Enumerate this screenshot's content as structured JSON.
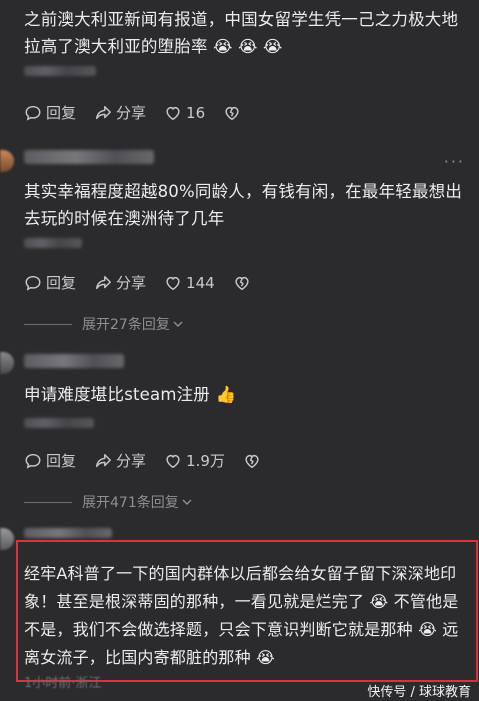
{
  "comments": [
    {
      "text": "之前澳大利亚新闻有报道，中国女留学生凭一己之力极大地拉高了澳大利亚的堕胎率 😭 😭 😭",
      "actions": {
        "reply": "回复",
        "share": "分享",
        "likes": "16"
      }
    },
    {
      "text": "其实幸福程度超越80%同龄人，有钱有闲，在最年轻最想出去玩的时候在澳洲待了几年",
      "actions": {
        "reply": "回复",
        "share": "分享",
        "likes": "144"
      },
      "expand": "展开27条回复"
    },
    {
      "text": "申请难度堪比steam注册 👍",
      "actions": {
        "reply": "回复",
        "share": "分享",
        "likes": "1.9万"
      },
      "expand": "展开471条回复"
    },
    {
      "text": "经牢A科普了一下的国内群体以后都会给女留子留下深深地印象！甚至是根深蒂固的那种，一看见就是烂完了 😭 不管他是不是，我们不会做选择题，只会下意识判断它就是那种 😭 远离女流子，比国内寄都脏的那种 😭",
      "footer_faint": "1小时前·浙江"
    }
  ],
  "more_label": "···",
  "watermark": "快传号 / 球球教育",
  "colors": {
    "background": "#2b2b2e",
    "highlight": "#d8343c"
  }
}
